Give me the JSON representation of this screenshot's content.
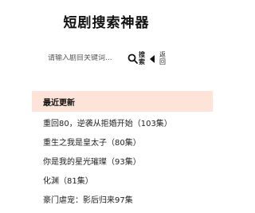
{
  "app": {
    "title": "短剧搜索神器"
  },
  "search": {
    "placeholder": "请输入剧目关键词...",
    "button_label_top": "搜",
    "button_label_bottom": "索",
    "back_label_top": "返",
    "back_label_bottom": "回"
  },
  "latest": {
    "header": "最近更新",
    "items": [
      {
        "label": "重回80，逆袭从拒婚开始（103集）"
      },
      {
        "label": "重生之我是皇太子（80集）"
      },
      {
        "label": "你是我的星光璀璨（93集）"
      },
      {
        "label": "化渊（81集）"
      },
      {
        "label": "豪门虐宠：影后归来97集"
      }
    ]
  }
}
